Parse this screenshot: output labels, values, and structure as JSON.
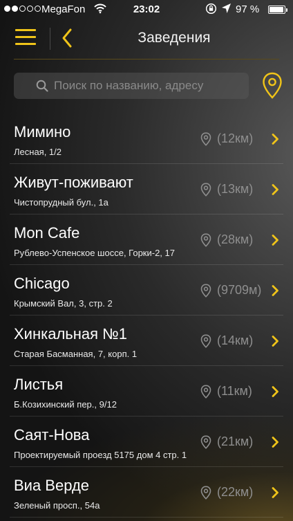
{
  "status_bar": {
    "carrier": "MegaFon",
    "time": "23:02",
    "battery": "97 %",
    "battery_level": 0.97
  },
  "nav": {
    "title": "Заведения"
  },
  "search": {
    "placeholder": "Поиск по названию, адресу",
    "value": ""
  },
  "colors": {
    "accent": "#f0c419",
    "distance": "#8e8e8e"
  },
  "venues": [
    {
      "name": "Мимино",
      "address": "Лесная, 1/2",
      "distance": "(12км)"
    },
    {
      "name": "Живут-поживают",
      "address": "Чистопрудный бул., 1а",
      "distance": "(13км)"
    },
    {
      "name": "Mon Cafe",
      "address": "Рублево-Успенское шоссе, Горки-2, 17",
      "distance": "(28км)"
    },
    {
      "name": "Chicago",
      "address": "Крымский Вал, 3, стр. 2",
      "distance": "(9709м)"
    },
    {
      "name": "Хинкальная №1",
      "address": "Старая Басманная, 7, корп. 1",
      "distance": "(14км)"
    },
    {
      "name": "Листья",
      "address": "Б.Козихинский пер., 9/12",
      "distance": "(11км)"
    },
    {
      "name": "Саят-Нова",
      "address": "Проектируемый проезд 5175 дом 4 стр. 1",
      "distance": "(21км)"
    },
    {
      "name": "Виа Верде",
      "address": "Зеленый просп., 54а",
      "distance": "(22км)"
    }
  ]
}
